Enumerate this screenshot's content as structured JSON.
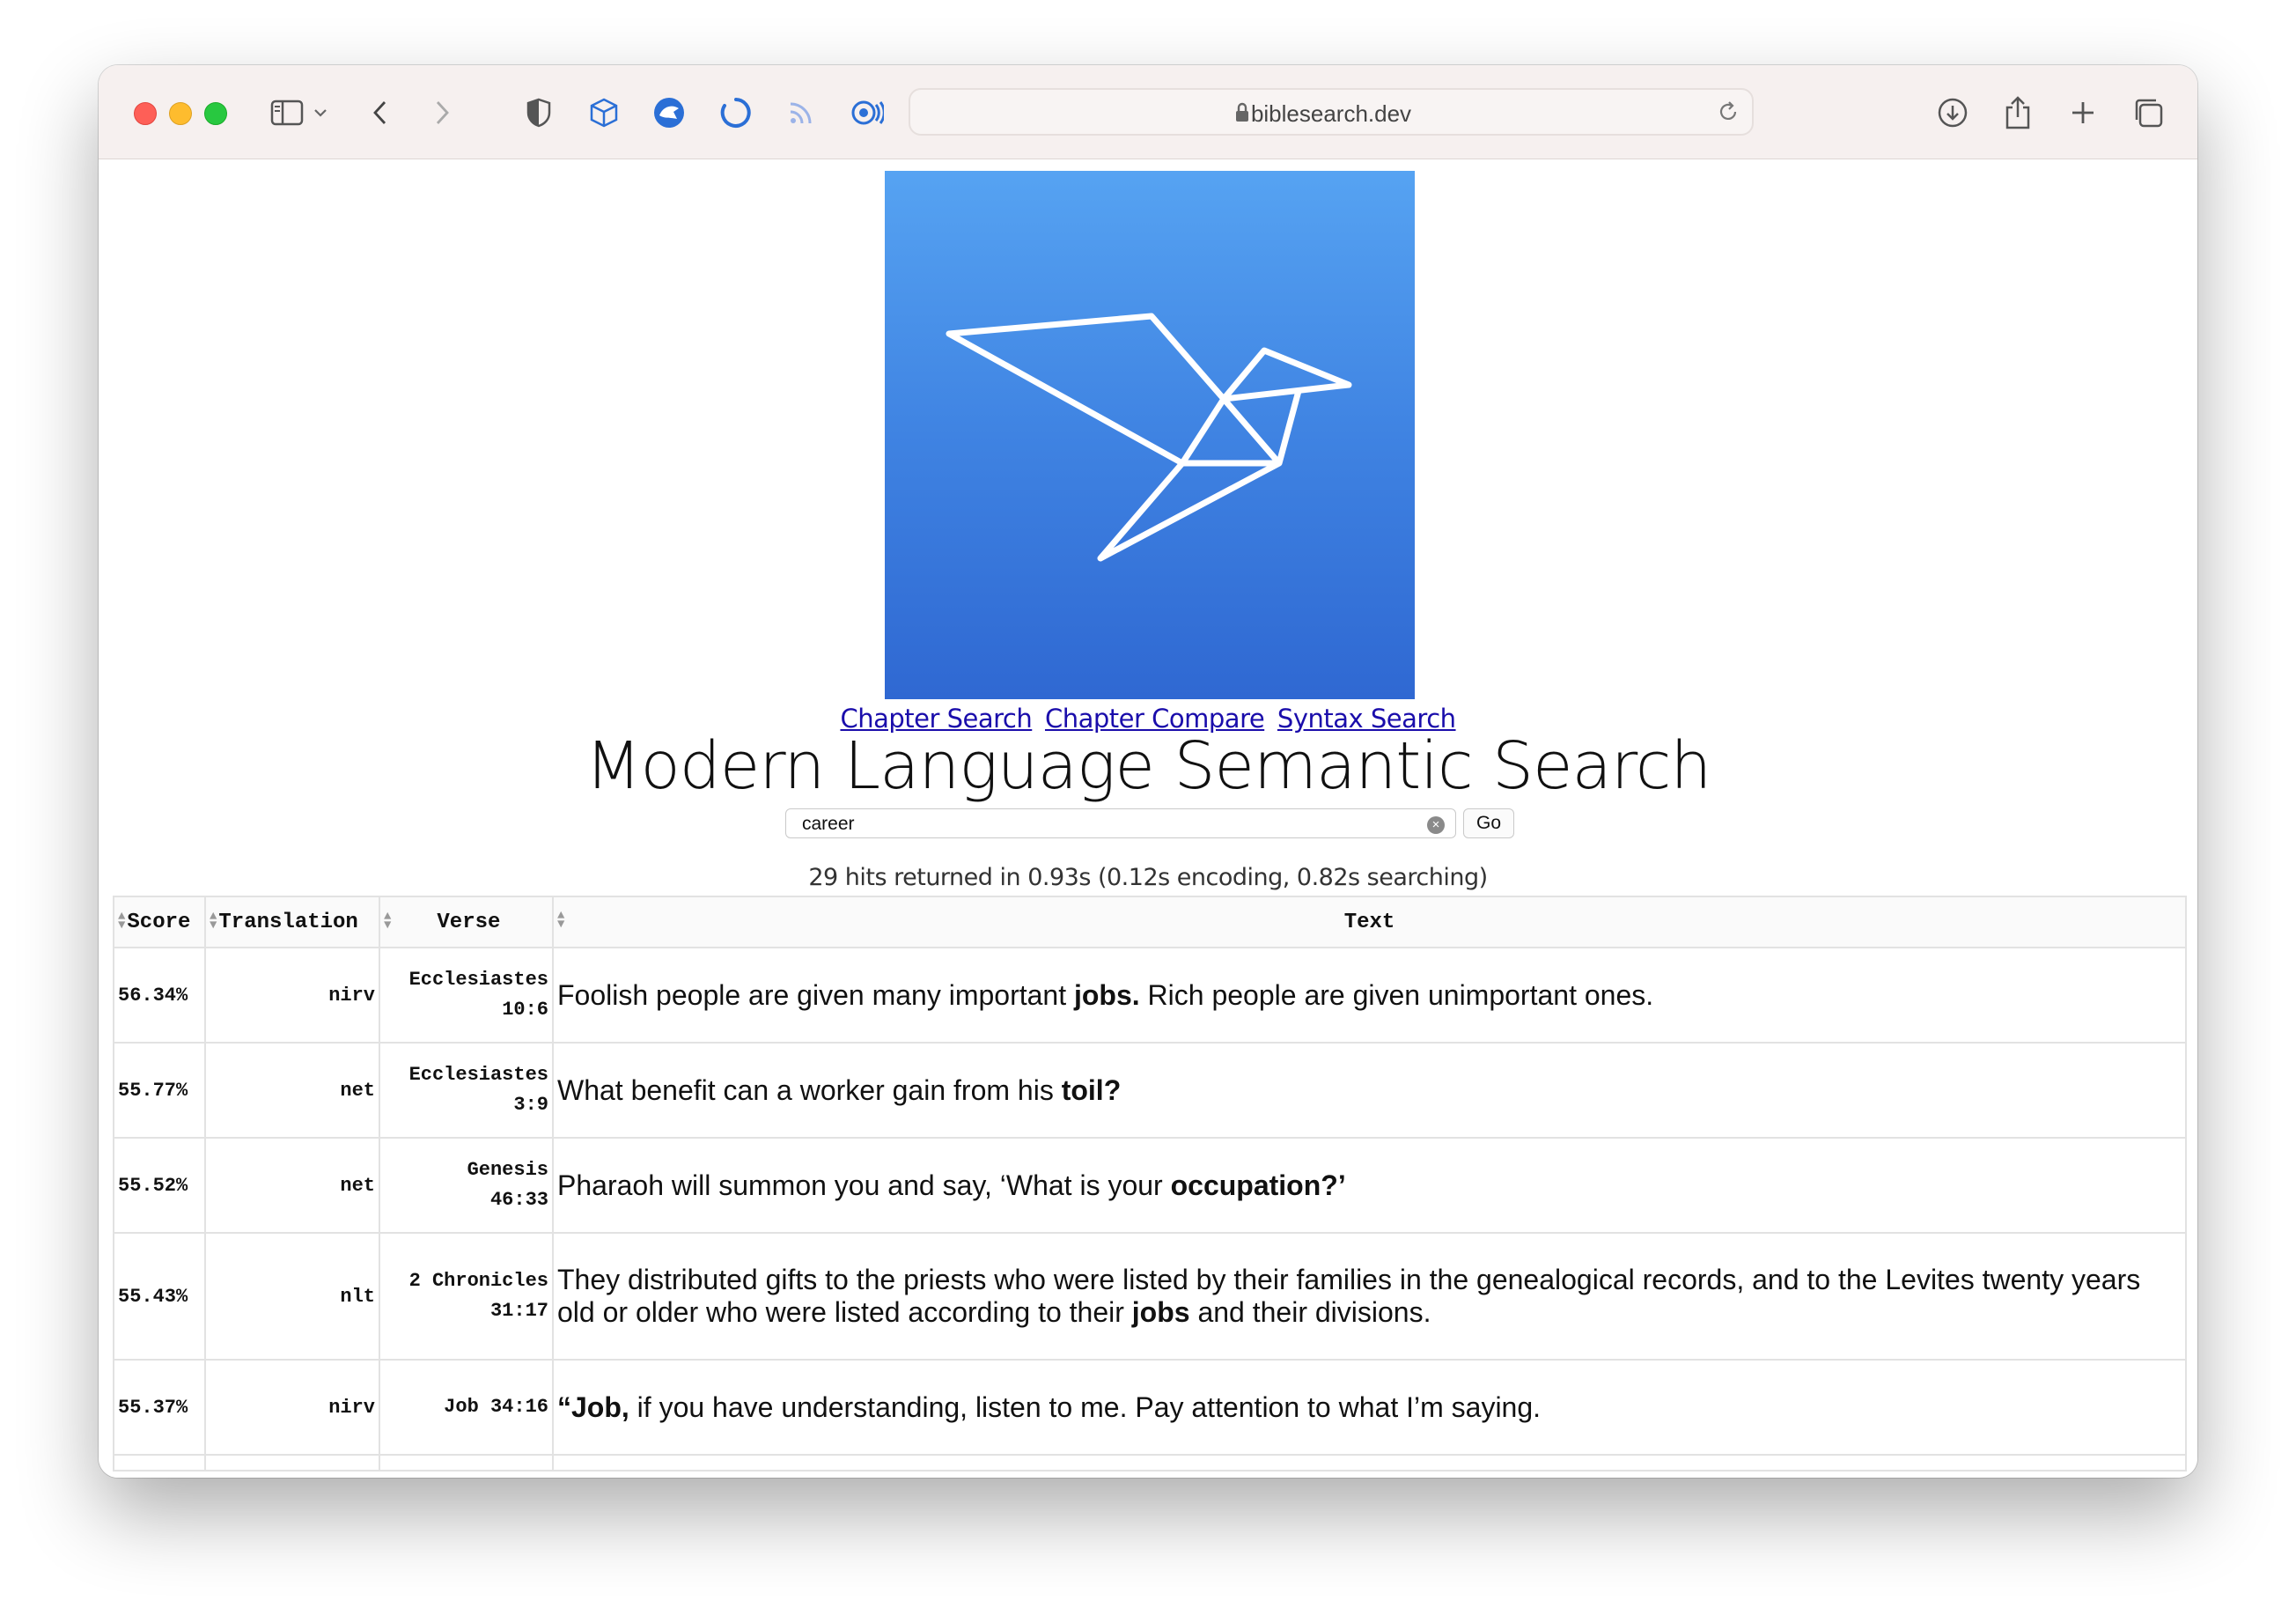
{
  "browser": {
    "url": "biblesearch.dev"
  },
  "page": {
    "nav_links": [
      "Chapter Search",
      "Chapter Compare",
      "Syntax Search"
    ],
    "title": "Modern Language Semantic Search",
    "search": {
      "value": "career",
      "go_label": "Go"
    },
    "hits_text": "29 hits returned in 0.93s (0.12s encoding, 0.82s searching)"
  },
  "table": {
    "headers": {
      "score": "Score",
      "translation": "Translation",
      "verse": "Verse",
      "text": "Text"
    },
    "rows": [
      {
        "score": "56.34%",
        "translation": "nirv",
        "book": "Ecclesiastes",
        "ref": "10:6",
        "text_before": "Foolish people are given many important ",
        "text_bold": "jobs.",
        "text_after": " Rich people are given unimportant ones."
      },
      {
        "score": "55.77%",
        "translation": "net",
        "book": "Ecclesiastes",
        "ref": "3:9",
        "text_before": "What benefit can a worker gain from his ",
        "text_bold": "toil?",
        "text_after": ""
      },
      {
        "score": "55.52%",
        "translation": "net",
        "book": "Genesis",
        "ref": "46:33",
        "text_before": "Pharaoh will summon you and say, ‘What is your ",
        "text_bold": "occupation?’",
        "text_after": ""
      },
      {
        "score": "55.43%",
        "translation": "nlt",
        "book": "2 Chronicles",
        "ref": "31:17",
        "text_before": "They distributed gifts to the priests who were listed by their families in the genealogical records, and to the Levites twenty years old or older who were listed according to their ",
        "text_bold": "jobs",
        "text_after": " and their divisions."
      },
      {
        "score": "55.37%",
        "translation": "nirv",
        "book": "Job 34:16",
        "ref": "",
        "text_before": "",
        "text_bold": "“Job,",
        "text_after": " if you have understanding, listen to me. Pay attention to what I’m saying."
      }
    ]
  },
  "colors": {
    "logo_top": "#56a3f2",
    "logo_bottom": "#2f68d2",
    "link": "#1a0dab"
  }
}
